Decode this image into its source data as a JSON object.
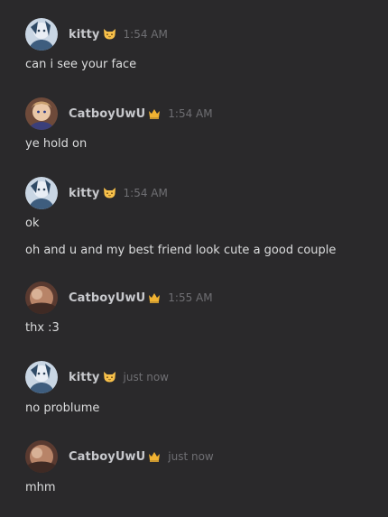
{
  "colors": {
    "background": "#2a292b",
    "username": "#c7c8cc",
    "timestamp": "#6f6f73",
    "message_text": "#dcddde",
    "crown": "#f0b232",
    "cat_face": "#f7c04a"
  },
  "messages": [
    {
      "author": "kitty",
      "badge_icon": "cat-face-icon",
      "time": "1:54 AM",
      "lines": [
        "can i see your face"
      ]
    },
    {
      "author": "CatboyUwU",
      "badge_icon": "crown-icon",
      "time": "1:54 AM",
      "lines": [
        "ye hold on"
      ]
    },
    {
      "author": "kitty",
      "badge_icon": "cat-face-icon",
      "time": "1:54 AM",
      "lines": [
        "ok",
        "oh and u and my best friend look cute a good couple"
      ]
    },
    {
      "author": "CatboyUwU",
      "badge_icon": "crown-icon",
      "time": "1:55 AM",
      "lines": [
        "thx :3"
      ]
    },
    {
      "author": "kitty",
      "badge_icon": "cat-face-icon",
      "time": "just now",
      "lines": [
        "no problume"
      ]
    },
    {
      "author": "CatboyUwU",
      "badge_icon": "crown-icon",
      "time": "just now",
      "lines": [
        "mhm"
      ]
    }
  ]
}
